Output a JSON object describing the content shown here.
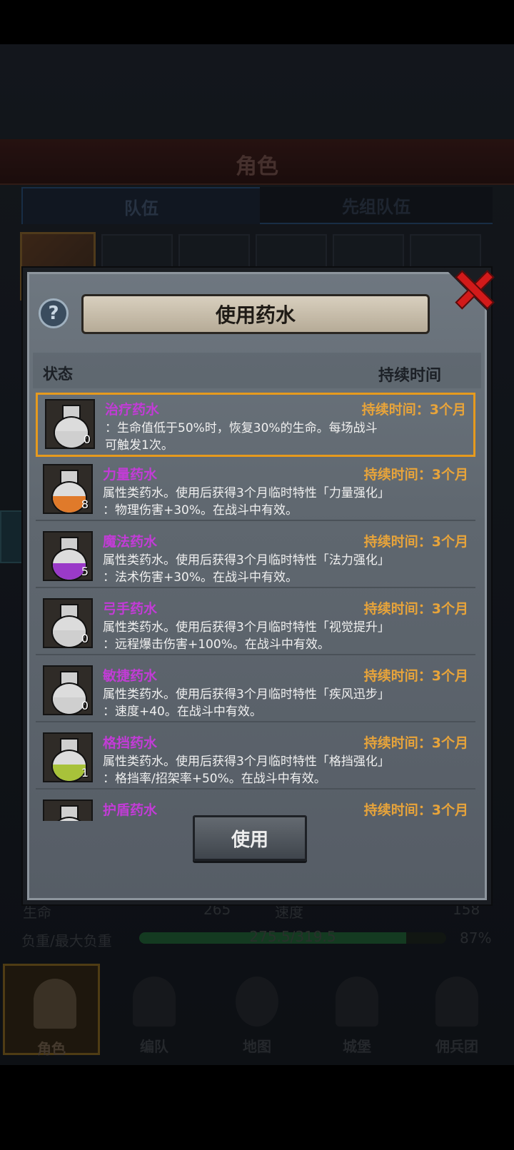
{
  "background": {
    "title": "角色",
    "tabs": [
      "队伍",
      "先组队伍"
    ],
    "stats": {
      "life_label": "生命",
      "life_value": "265",
      "speed_label": "速度",
      "speed_value": "158",
      "load_label": "负重/最大负重",
      "load_value": "275.5/319.5",
      "load_percent": "87%",
      "load_fraction": 0.87
    },
    "nav": [
      {
        "label": "角色",
        "icon": "knight-icon",
        "active": true
      },
      {
        "label": "编队",
        "icon": "helmet-icon",
        "active": false
      },
      {
        "label": "地图",
        "icon": "map-icon",
        "active": false
      },
      {
        "label": "城堡",
        "icon": "castle-icon",
        "active": false
      },
      {
        "label": "佣兵团",
        "icon": "tower-icon",
        "active": false
      }
    ]
  },
  "modal": {
    "title": "使用药水",
    "help_icon": "question-icon",
    "close_icon": "close-icon",
    "columns": {
      "status": "状态",
      "duration": "持续时间"
    },
    "use_button": "使用",
    "items": [
      {
        "name": "治疗药水",
        "duration": "持续时间：3个月",
        "count": "0",
        "color": "#cfcfcf",
        "line1": "：生命值低于50%时，恢复30%的生命。每场战斗",
        "line2": "可触发1次。",
        "selected": true
      },
      {
        "name": "力量药水",
        "duration": "持续时间：3个月",
        "count": "8",
        "color": "#e07a2a",
        "line1": "属性类药水。使用后获得3个月临时特性「力量强化」",
        "line2": "：物理伤害+30%。在战斗中有效。"
      },
      {
        "name": "魔法药水",
        "duration": "持续时间：3个月",
        "count": "5",
        "color": "#9a3ac8",
        "line1": "属性类药水。使用后获得3个月临时特性「法力强化」",
        "line2": "：法术伤害+30%。在战斗中有效。"
      },
      {
        "name": "弓手药水",
        "duration": "持续时间：3个月",
        "count": "0",
        "color": "#cfcfcf",
        "line1": "属性类药水。使用后获得3个月临时特性「视觉提升」",
        "line2": "：远程爆击伤害+100%。在战斗中有效。"
      },
      {
        "name": "敏捷药水",
        "duration": "持续时间：3个月",
        "count": "0",
        "color": "#cfcfcf",
        "line1": "属性类药水。使用后获得3个月临时特性「疾风迅步」",
        "line2": "：速度+40。在战斗中有效。"
      },
      {
        "name": "格挡药水",
        "duration": "持续时间：3个月",
        "count": "1",
        "color": "#a8c23a",
        "line1": "属性类药水。使用后获得3个月临时特性「格挡强化」",
        "line2": "：格挡率/招架率+50%。在战斗中有效。"
      },
      {
        "name": "护盾药水",
        "duration": "持续时间：3个月",
        "count": "",
        "color": "#cfcfcf",
        "line1": "",
        "line2": ""
      }
    ]
  }
}
